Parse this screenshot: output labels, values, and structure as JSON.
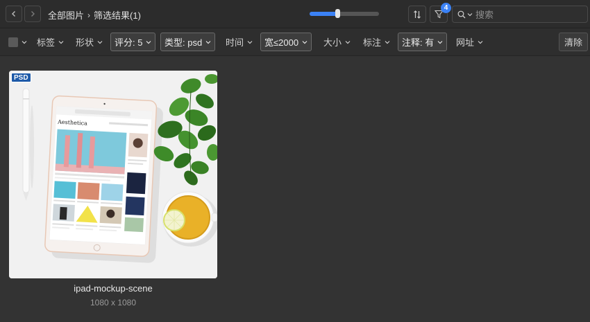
{
  "topbar": {
    "back_icon": "chevron-left-icon",
    "forward_icon": "chevron-right-icon",
    "breadcrumb_root": "全部图片",
    "breadcrumb_sep": "›",
    "breadcrumb_current": "筛选结果(1)",
    "zoom_level": 0.4,
    "filter_count": "4",
    "search_placeholder": "搜索"
  },
  "filterbar": {
    "items": [
      {
        "label": "标签",
        "active": false
      },
      {
        "label": "形状",
        "active": false
      },
      {
        "label": "评分: 5",
        "active": true
      },
      {
        "label": "类型: psd",
        "active": true
      },
      {
        "label": "时间",
        "active": false
      },
      {
        "label": "宽≤2000",
        "active": true
      },
      {
        "label": "大小",
        "active": false
      },
      {
        "label": "标注",
        "active": false
      },
      {
        "label": "注释: 有",
        "active": true
      },
      {
        "label": "网址",
        "active": false
      }
    ],
    "clear_label": "清除"
  },
  "results": [
    {
      "badge": "PSD",
      "name": "ipad-mockup-scene",
      "dimensions": "1080 x 1080",
      "tablet_heading": "Aesthetica"
    }
  ],
  "colors": {
    "accent": "#3b82f6",
    "background": "#333333",
    "badge": "#1e5aa8"
  }
}
